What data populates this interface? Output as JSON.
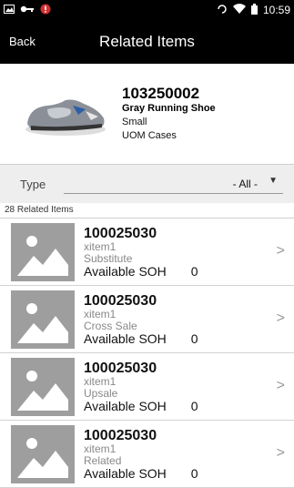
{
  "status": {
    "time": "10:59"
  },
  "appbar": {
    "back_label": "Back",
    "title": "Related Items"
  },
  "item": {
    "number": "103250002",
    "description": "Gray Running Shoe",
    "size": "Small",
    "uom": "UOM Cases"
  },
  "filter": {
    "label": "Type",
    "value": "- All -"
  },
  "count_text": "28 Related Items",
  "items": [
    {
      "number": "100025030",
      "desc": "xitem1",
      "type": "Substitute",
      "soh_label": "Available SOH",
      "soh_value": "0"
    },
    {
      "number": "100025030",
      "desc": "xitem1",
      "type": "Cross Sale",
      "soh_label": "Available SOH",
      "soh_value": "0"
    },
    {
      "number": "100025030",
      "desc": "xitem1",
      "type": "Upsale",
      "soh_label": "Available SOH",
      "soh_value": "0"
    },
    {
      "number": "100025030",
      "desc": "xitem1",
      "type": "Related",
      "soh_label": "Available SOH",
      "soh_value": "0"
    }
  ]
}
